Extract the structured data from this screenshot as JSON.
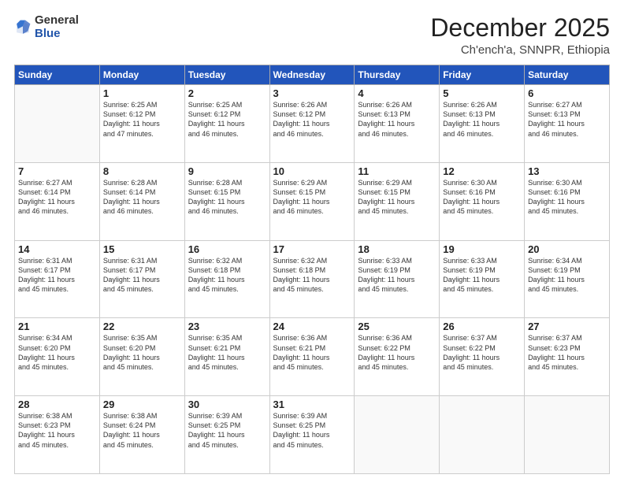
{
  "logo": {
    "general": "General",
    "blue": "Blue"
  },
  "title": {
    "month_year": "December 2025",
    "location": "Ch'ench'a, SNNPR, Ethiopia"
  },
  "weekdays": [
    "Sunday",
    "Monday",
    "Tuesday",
    "Wednesday",
    "Thursday",
    "Friday",
    "Saturday"
  ],
  "weeks": [
    [
      {
        "day": "",
        "info": ""
      },
      {
        "day": "1",
        "info": "Sunrise: 6:25 AM\nSunset: 6:12 PM\nDaylight: 11 hours\nand 47 minutes."
      },
      {
        "day": "2",
        "info": "Sunrise: 6:25 AM\nSunset: 6:12 PM\nDaylight: 11 hours\nand 46 minutes."
      },
      {
        "day": "3",
        "info": "Sunrise: 6:26 AM\nSunset: 6:12 PM\nDaylight: 11 hours\nand 46 minutes."
      },
      {
        "day": "4",
        "info": "Sunrise: 6:26 AM\nSunset: 6:13 PM\nDaylight: 11 hours\nand 46 minutes."
      },
      {
        "day": "5",
        "info": "Sunrise: 6:26 AM\nSunset: 6:13 PM\nDaylight: 11 hours\nand 46 minutes."
      },
      {
        "day": "6",
        "info": "Sunrise: 6:27 AM\nSunset: 6:13 PM\nDaylight: 11 hours\nand 46 minutes."
      }
    ],
    [
      {
        "day": "7",
        "info": "Sunrise: 6:27 AM\nSunset: 6:14 PM\nDaylight: 11 hours\nand 46 minutes."
      },
      {
        "day": "8",
        "info": "Sunrise: 6:28 AM\nSunset: 6:14 PM\nDaylight: 11 hours\nand 46 minutes."
      },
      {
        "day": "9",
        "info": "Sunrise: 6:28 AM\nSunset: 6:15 PM\nDaylight: 11 hours\nand 46 minutes."
      },
      {
        "day": "10",
        "info": "Sunrise: 6:29 AM\nSunset: 6:15 PM\nDaylight: 11 hours\nand 46 minutes."
      },
      {
        "day": "11",
        "info": "Sunrise: 6:29 AM\nSunset: 6:15 PM\nDaylight: 11 hours\nand 45 minutes."
      },
      {
        "day": "12",
        "info": "Sunrise: 6:30 AM\nSunset: 6:16 PM\nDaylight: 11 hours\nand 45 minutes."
      },
      {
        "day": "13",
        "info": "Sunrise: 6:30 AM\nSunset: 6:16 PM\nDaylight: 11 hours\nand 45 minutes."
      }
    ],
    [
      {
        "day": "14",
        "info": "Sunrise: 6:31 AM\nSunset: 6:17 PM\nDaylight: 11 hours\nand 45 minutes."
      },
      {
        "day": "15",
        "info": "Sunrise: 6:31 AM\nSunset: 6:17 PM\nDaylight: 11 hours\nand 45 minutes."
      },
      {
        "day": "16",
        "info": "Sunrise: 6:32 AM\nSunset: 6:18 PM\nDaylight: 11 hours\nand 45 minutes."
      },
      {
        "day": "17",
        "info": "Sunrise: 6:32 AM\nSunset: 6:18 PM\nDaylight: 11 hours\nand 45 minutes."
      },
      {
        "day": "18",
        "info": "Sunrise: 6:33 AM\nSunset: 6:19 PM\nDaylight: 11 hours\nand 45 minutes."
      },
      {
        "day": "19",
        "info": "Sunrise: 6:33 AM\nSunset: 6:19 PM\nDaylight: 11 hours\nand 45 minutes."
      },
      {
        "day": "20",
        "info": "Sunrise: 6:34 AM\nSunset: 6:19 PM\nDaylight: 11 hours\nand 45 minutes."
      }
    ],
    [
      {
        "day": "21",
        "info": "Sunrise: 6:34 AM\nSunset: 6:20 PM\nDaylight: 11 hours\nand 45 minutes."
      },
      {
        "day": "22",
        "info": "Sunrise: 6:35 AM\nSunset: 6:20 PM\nDaylight: 11 hours\nand 45 minutes."
      },
      {
        "day": "23",
        "info": "Sunrise: 6:35 AM\nSunset: 6:21 PM\nDaylight: 11 hours\nand 45 minutes."
      },
      {
        "day": "24",
        "info": "Sunrise: 6:36 AM\nSunset: 6:21 PM\nDaylight: 11 hours\nand 45 minutes."
      },
      {
        "day": "25",
        "info": "Sunrise: 6:36 AM\nSunset: 6:22 PM\nDaylight: 11 hours\nand 45 minutes."
      },
      {
        "day": "26",
        "info": "Sunrise: 6:37 AM\nSunset: 6:22 PM\nDaylight: 11 hours\nand 45 minutes."
      },
      {
        "day": "27",
        "info": "Sunrise: 6:37 AM\nSunset: 6:23 PM\nDaylight: 11 hours\nand 45 minutes."
      }
    ],
    [
      {
        "day": "28",
        "info": "Sunrise: 6:38 AM\nSunset: 6:23 PM\nDaylight: 11 hours\nand 45 minutes."
      },
      {
        "day": "29",
        "info": "Sunrise: 6:38 AM\nSunset: 6:24 PM\nDaylight: 11 hours\nand 45 minutes."
      },
      {
        "day": "30",
        "info": "Sunrise: 6:39 AM\nSunset: 6:25 PM\nDaylight: 11 hours\nand 45 minutes."
      },
      {
        "day": "31",
        "info": "Sunrise: 6:39 AM\nSunset: 6:25 PM\nDaylight: 11 hours\nand 45 minutes."
      },
      {
        "day": "",
        "info": ""
      },
      {
        "day": "",
        "info": ""
      },
      {
        "day": "",
        "info": ""
      }
    ]
  ]
}
